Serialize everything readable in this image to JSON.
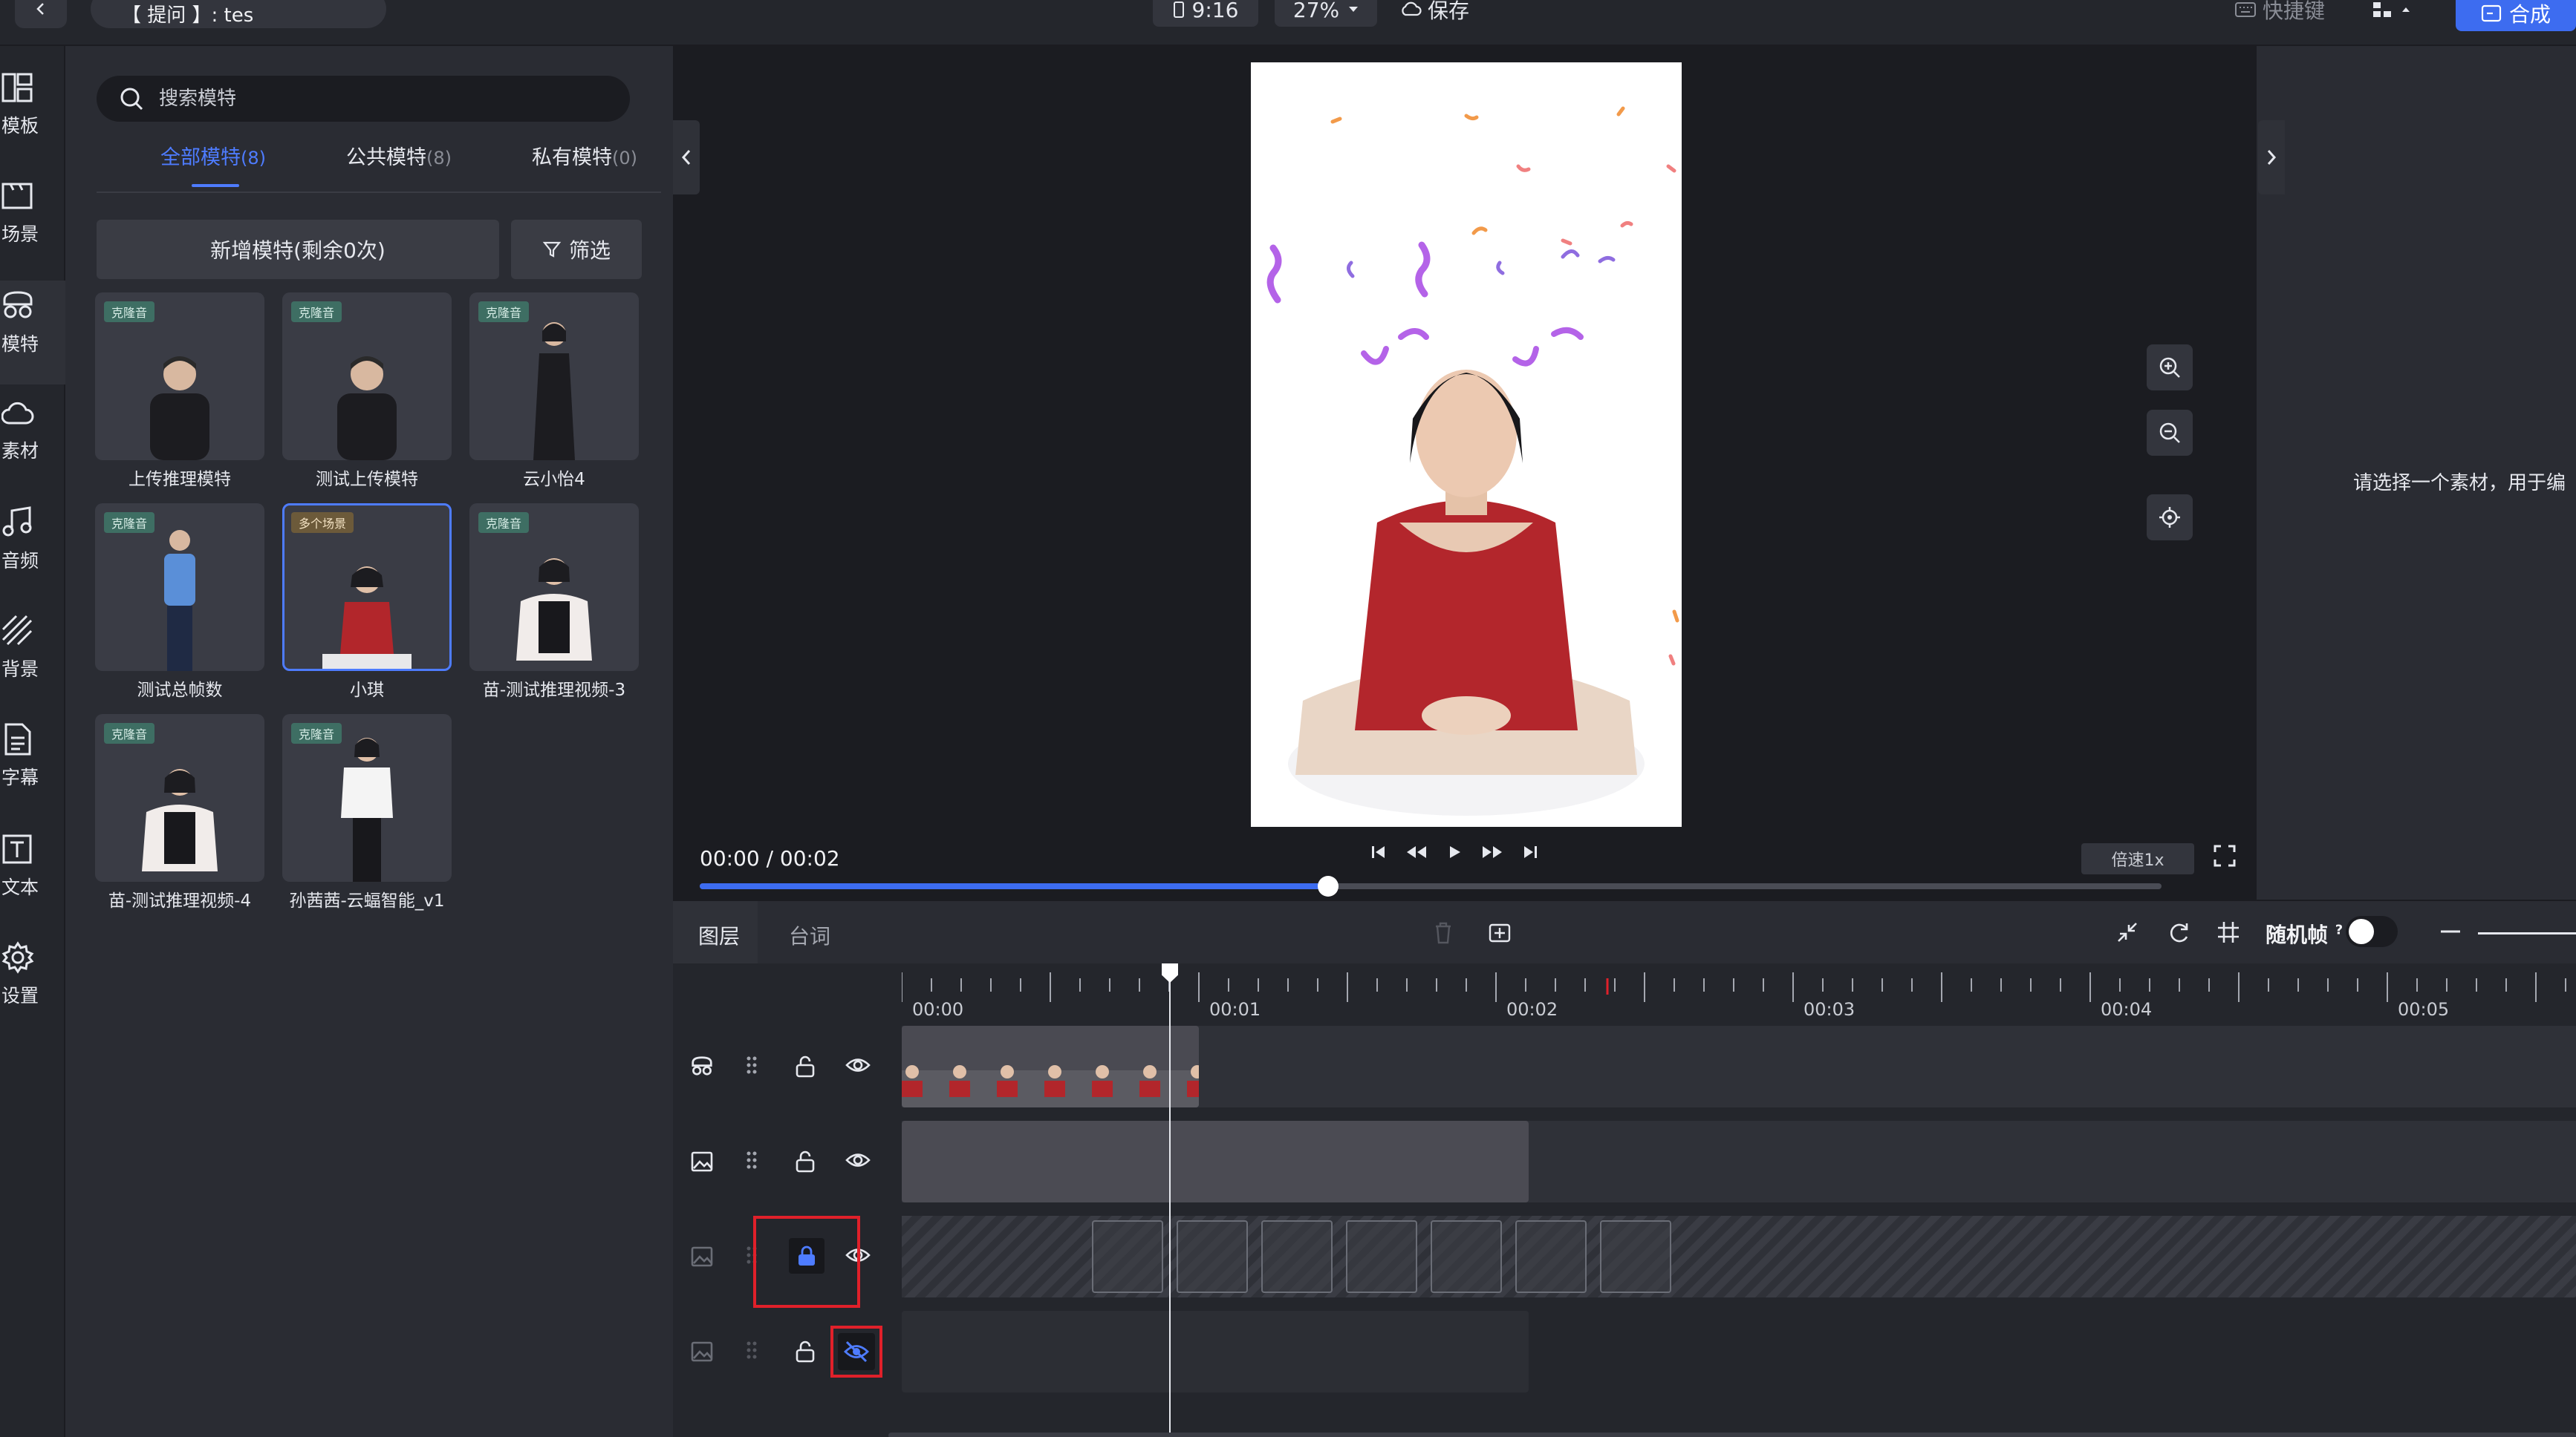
{
  "topbar": {
    "title": "【 提问 】: tes",
    "ratio": "9:16",
    "zoom": "27%",
    "save": "保存",
    "shortcut": "快捷键",
    "compose": "合成",
    "accent": "#3d6cf0"
  },
  "nav": [
    {
      "label": "模板",
      "icon": "template-icon"
    },
    {
      "label": "场景",
      "icon": "scene-icon"
    },
    {
      "label": "模特",
      "icon": "model-icon"
    },
    {
      "label": "素材",
      "icon": "cloud-icon"
    },
    {
      "label": "音频",
      "icon": "music-icon"
    },
    {
      "label": "背景",
      "icon": "background-icon"
    },
    {
      "label": "字幕",
      "icon": "subtitle-icon"
    },
    {
      "label": "文本",
      "icon": "text-icon"
    },
    {
      "label": "设置",
      "icon": "settings-icon"
    }
  ],
  "panel": {
    "search_placeholder": "搜索模特",
    "tabs": [
      {
        "label": "全部模特",
        "count": "(8)"
      },
      {
        "label": "公共模特",
        "count": "(8)"
      },
      {
        "label": "私有模特",
        "count": "(0)"
      }
    ],
    "add_model": "新增模特(剩余0次)",
    "filter": "筛选",
    "models": [
      {
        "name": "上传推理模特",
        "badge": "克隆音"
      },
      {
        "name": "测试上传模特",
        "badge": "克隆音"
      },
      {
        "name": "云小怡4",
        "badge": "克隆音"
      },
      {
        "name": "测试总帧数",
        "badge": "克隆音"
      },
      {
        "name": "小琪",
        "badge": "多个场景"
      },
      {
        "name": "苗-测试推理视频-3",
        "badge": "克隆音"
      },
      {
        "name": "苗-测试推理视频-4",
        "badge": "克隆音"
      },
      {
        "name": "孙茜茜-云蝠智能_v1",
        "badge": "克隆音"
      }
    ]
  },
  "player": {
    "time": "00:00 / 00:02",
    "speed": "倍速1x",
    "progress": 0.43
  },
  "right": {
    "hint": "请选择一个素材，用于编"
  },
  "timeline": {
    "tab_layers": "图层",
    "tab_lyrics": "台词",
    "random_frame": "随机帧",
    "ticks": [
      "00:00",
      "00:01",
      "00:02",
      "00:03",
      "00:04",
      "00:05"
    ]
  }
}
